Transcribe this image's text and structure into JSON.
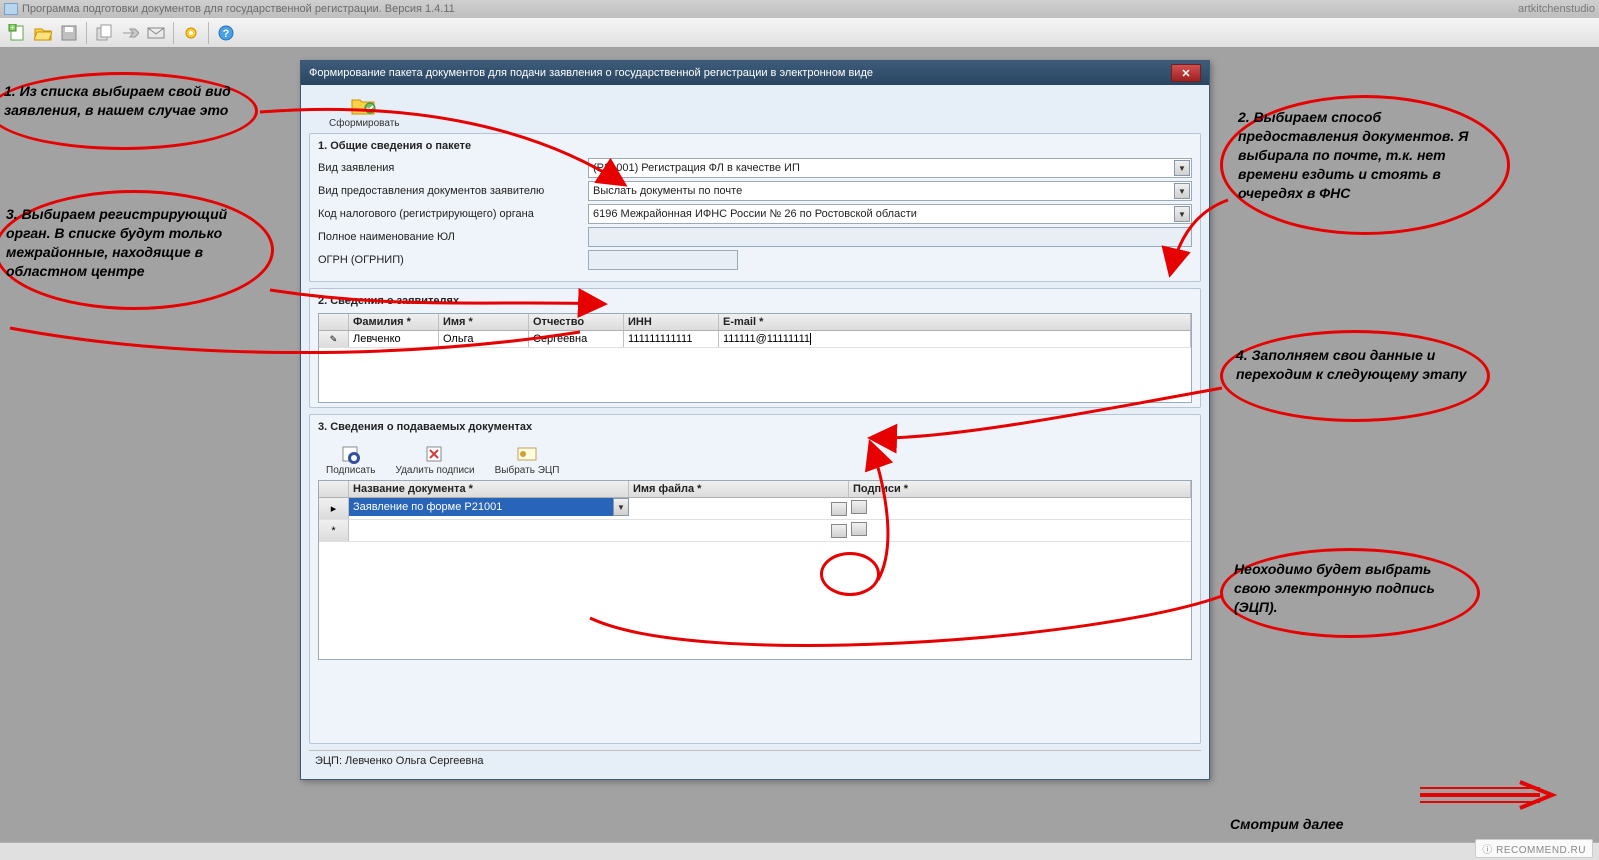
{
  "app_title": "Программа подготовки документов для государственной регистрации. Версия 1.4.11",
  "top_right": "artkitchenstudio",
  "dialog_title": "Формирование пакета документов для подачи заявления о государственной регистрации в электронном виде",
  "form_btn": "Сформировать",
  "s1": {
    "title": "1. Общие сведения о пакете",
    "f1_label": "Вид заявления",
    "f1_value": "(Р21001) Регистрация ФЛ в качестве ИП",
    "f2_label": "Вид предоставления документов заявителю",
    "f2_value": "Выслать документы по почте",
    "f3_label": "Код налогового (регистрирующего) органа",
    "f3_value": "6196 Межрайонная ИФНС России № 26 по Ростовской области",
    "f4_label": "Полное наименование ЮЛ",
    "f5_label": "ОГРН (ОГРНИП)"
  },
  "s2": {
    "title": "2. Сведения о заявителях",
    "cols": {
      "c1": "Фамилия *",
      "c2": "Имя *",
      "c3": "Отчество",
      "c4": "ИНН",
      "c5": "E-mail *"
    },
    "row": {
      "c1": "Левченко",
      "c2": "Ольга",
      "c3": "Сергеевна",
      "c4": "111111111111",
      "c5": "111111@11111111"
    }
  },
  "s3": {
    "title": "3.  Сведения о подаваемых документах",
    "b1": "Подписать",
    "b2": "Удалить подписи",
    "b3": "Выбрать ЭЦП",
    "cols": {
      "c1": "Название документа *",
      "c2": "Имя файла *",
      "c3": "Подписи *"
    },
    "row1": "Заявление по форме Р21001"
  },
  "status": "ЭЦП: Левченко Ольга Сергеевна",
  "annotations": {
    "a1": "1. Из списка выбираем свой вид заявления, в нашем случае это",
    "a2": "2. Выбираем способ предоставления документов. Я выбирала по почте, т.к. нет времени ездить и стоять в очередях в ФНС",
    "a3": "3. Выбираем регистрирующий орган. В списке будут только межрайонные, находящие в областном центре",
    "a4": "4. Заполняем свои данные и переходим к следующему этапу",
    "a5": "Неоходимо будет выбрать свою электронную подпись (ЭЦП).",
    "a6": "Смотрим далее"
  },
  "watermark": "RECOMMEND.RU"
}
